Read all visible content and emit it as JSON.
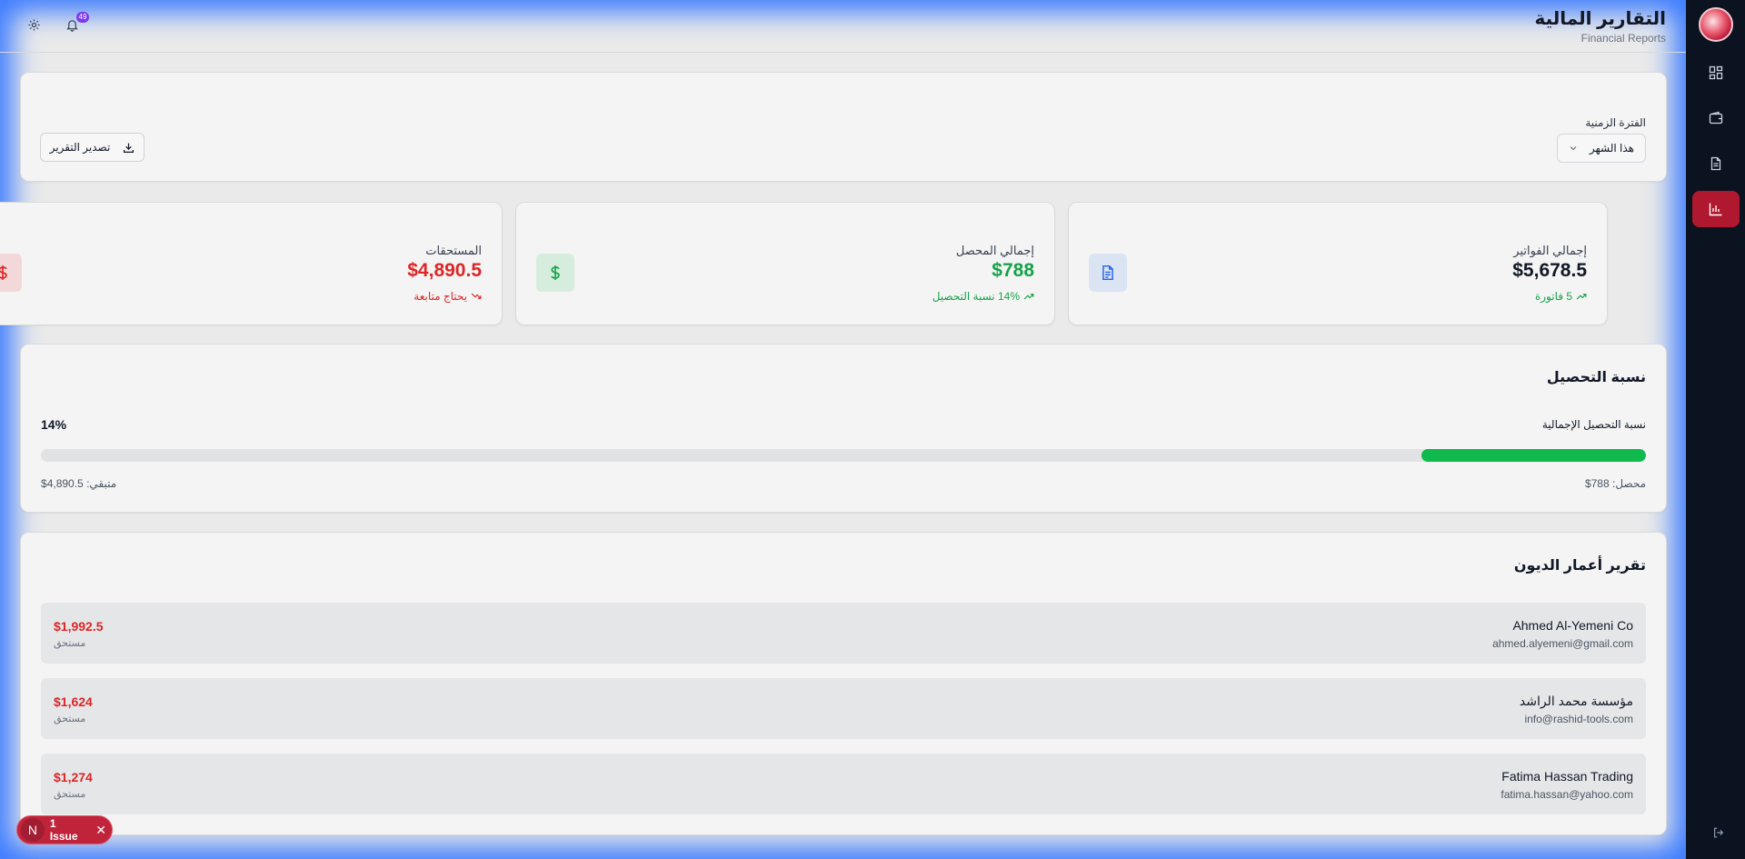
{
  "header": {
    "title": "التقارير المالية",
    "subtitle": "Financial Reports",
    "notification_count": "49"
  },
  "filter": {
    "period_label": "الفترة الزمنية",
    "period_value": "هذا الشهر",
    "export_label": "تصدير التقرير"
  },
  "stats": [
    {
      "label": "إجمالي الفواتير",
      "value": "$5,678.5",
      "sub": "5 فاتورة",
      "color": "#111827",
      "sub_color": "#16a34a",
      "icon": "file-text-icon",
      "icon_bg": "#dbe4f3",
      "icon_color": "#2563eb"
    },
    {
      "label": "إجمالي المحصل",
      "value": "$788",
      "sub": "14% نسبة التحصيل",
      "color": "#16a34a",
      "sub_color": "#16a34a",
      "icon": "dollar-icon",
      "icon_bg": "#d6ecdc",
      "icon_color": "#16a34a"
    },
    {
      "label": "المستحقات",
      "value": "$4,890.5",
      "sub": "يحتاج متابعة",
      "color": "#dc2626",
      "sub_color": "#dc2626",
      "icon": "dollar-icon",
      "icon_bg": "#f2d8d9",
      "icon_color": "#dc2626"
    }
  ],
  "collection": {
    "title": "نسبة التحصيل",
    "overall_label": "نسبة التحصيل الإجمالية",
    "percent_text": "14%",
    "percent_value": 14,
    "collected": "محصل: 788$",
    "remaining": "متبقي: 4,890.5$"
  },
  "aging": {
    "title": "تقرير أعمار الديون",
    "rows": [
      {
        "name": "Ahmed Al-Yemeni Co",
        "email": "ahmed.alyemeni@gmail.com",
        "amount": "$1,992.5",
        "status": "مستحق"
      },
      {
        "name": "مؤسسة محمد الراشد",
        "email": "info@rashid-tools.com",
        "amount": "$1,624",
        "status": "مستحق"
      },
      {
        "name": "Fatima Hassan Trading",
        "email": "fatima.hassan@yahoo.com",
        "amount": "$1,274",
        "status": "مستحق"
      }
    ]
  },
  "issue": {
    "letter": "N",
    "label": "1 Issue"
  },
  "colors": {
    "accent": "#b0182f",
    "sidebar": "#0b1220",
    "progress": "#10b94e"
  }
}
